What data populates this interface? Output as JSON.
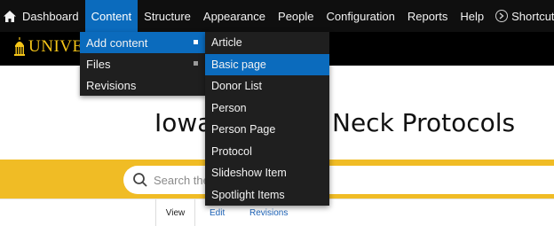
{
  "toolbar": {
    "items": [
      "Dashboard",
      "Content",
      "Structure",
      "Appearance",
      "People",
      "Configuration",
      "Reports",
      "Help",
      "Shortcuts"
    ],
    "active": "Content",
    "bg_color": "#0f0f0f",
    "active_color": "#0b6bbd"
  },
  "header": {
    "logo_text": "UNIVER",
    "logo_color": "#f5c518"
  },
  "content_menu": {
    "items": [
      "Add content",
      "Files",
      "Revisions"
    ],
    "active": "Add content"
  },
  "add_content_menu": {
    "items": [
      "Article",
      "Basic page",
      "Donor List",
      "Person",
      "Person Page",
      "Protocol",
      "Slideshow Item",
      "Spotlight Items"
    ],
    "active": "Basic page"
  },
  "page": {
    "title_part1": "Iowa",
    "title_part2": "Neck Protocols"
  },
  "search": {
    "placeholder": "Search the",
    "band_color": "#f0bc25"
  },
  "tabs": [
    "View",
    "Edit",
    "Revisions"
  ]
}
